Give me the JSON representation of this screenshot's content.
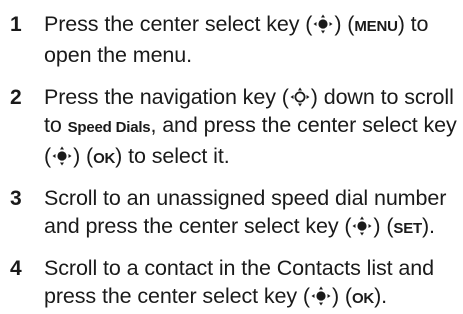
{
  "steps": [
    {
      "number": "1",
      "parts": [
        {
          "text": "Press the center select key ("
        },
        {
          "icon": "center-select-key-icon"
        },
        {
          "text": ") ("
        },
        {
          "key": "MENU"
        },
        {
          "text": ") to open the menu."
        }
      ]
    },
    {
      "number": "2",
      "parts": [
        {
          "text": "Press the navigation key ("
        },
        {
          "icon": "navigation-key-icon"
        },
        {
          "text": ") down to scroll to "
        },
        {
          "key": "Speed Dials"
        },
        {
          "text": ", and press the center select key ("
        },
        {
          "icon": "center-select-key-icon"
        },
        {
          "text": ") ("
        },
        {
          "key": "OK"
        },
        {
          "text": ") to select it."
        }
      ]
    },
    {
      "number": "3",
      "parts": [
        {
          "text": "Scroll to an unassigned speed dial number and press the center select key ("
        },
        {
          "icon": "center-select-key-icon"
        },
        {
          "text": ") ("
        },
        {
          "key": "SET"
        },
        {
          "text": ")."
        }
      ]
    },
    {
      "number": "4",
      "parts": [
        {
          "text": "Scroll to a contact in the Contacts list and press the center select key ("
        },
        {
          "icon": "center-select-key-icon"
        },
        {
          "text": ") ("
        },
        {
          "key": "OK"
        },
        {
          "text": ")."
        }
      ]
    }
  ]
}
